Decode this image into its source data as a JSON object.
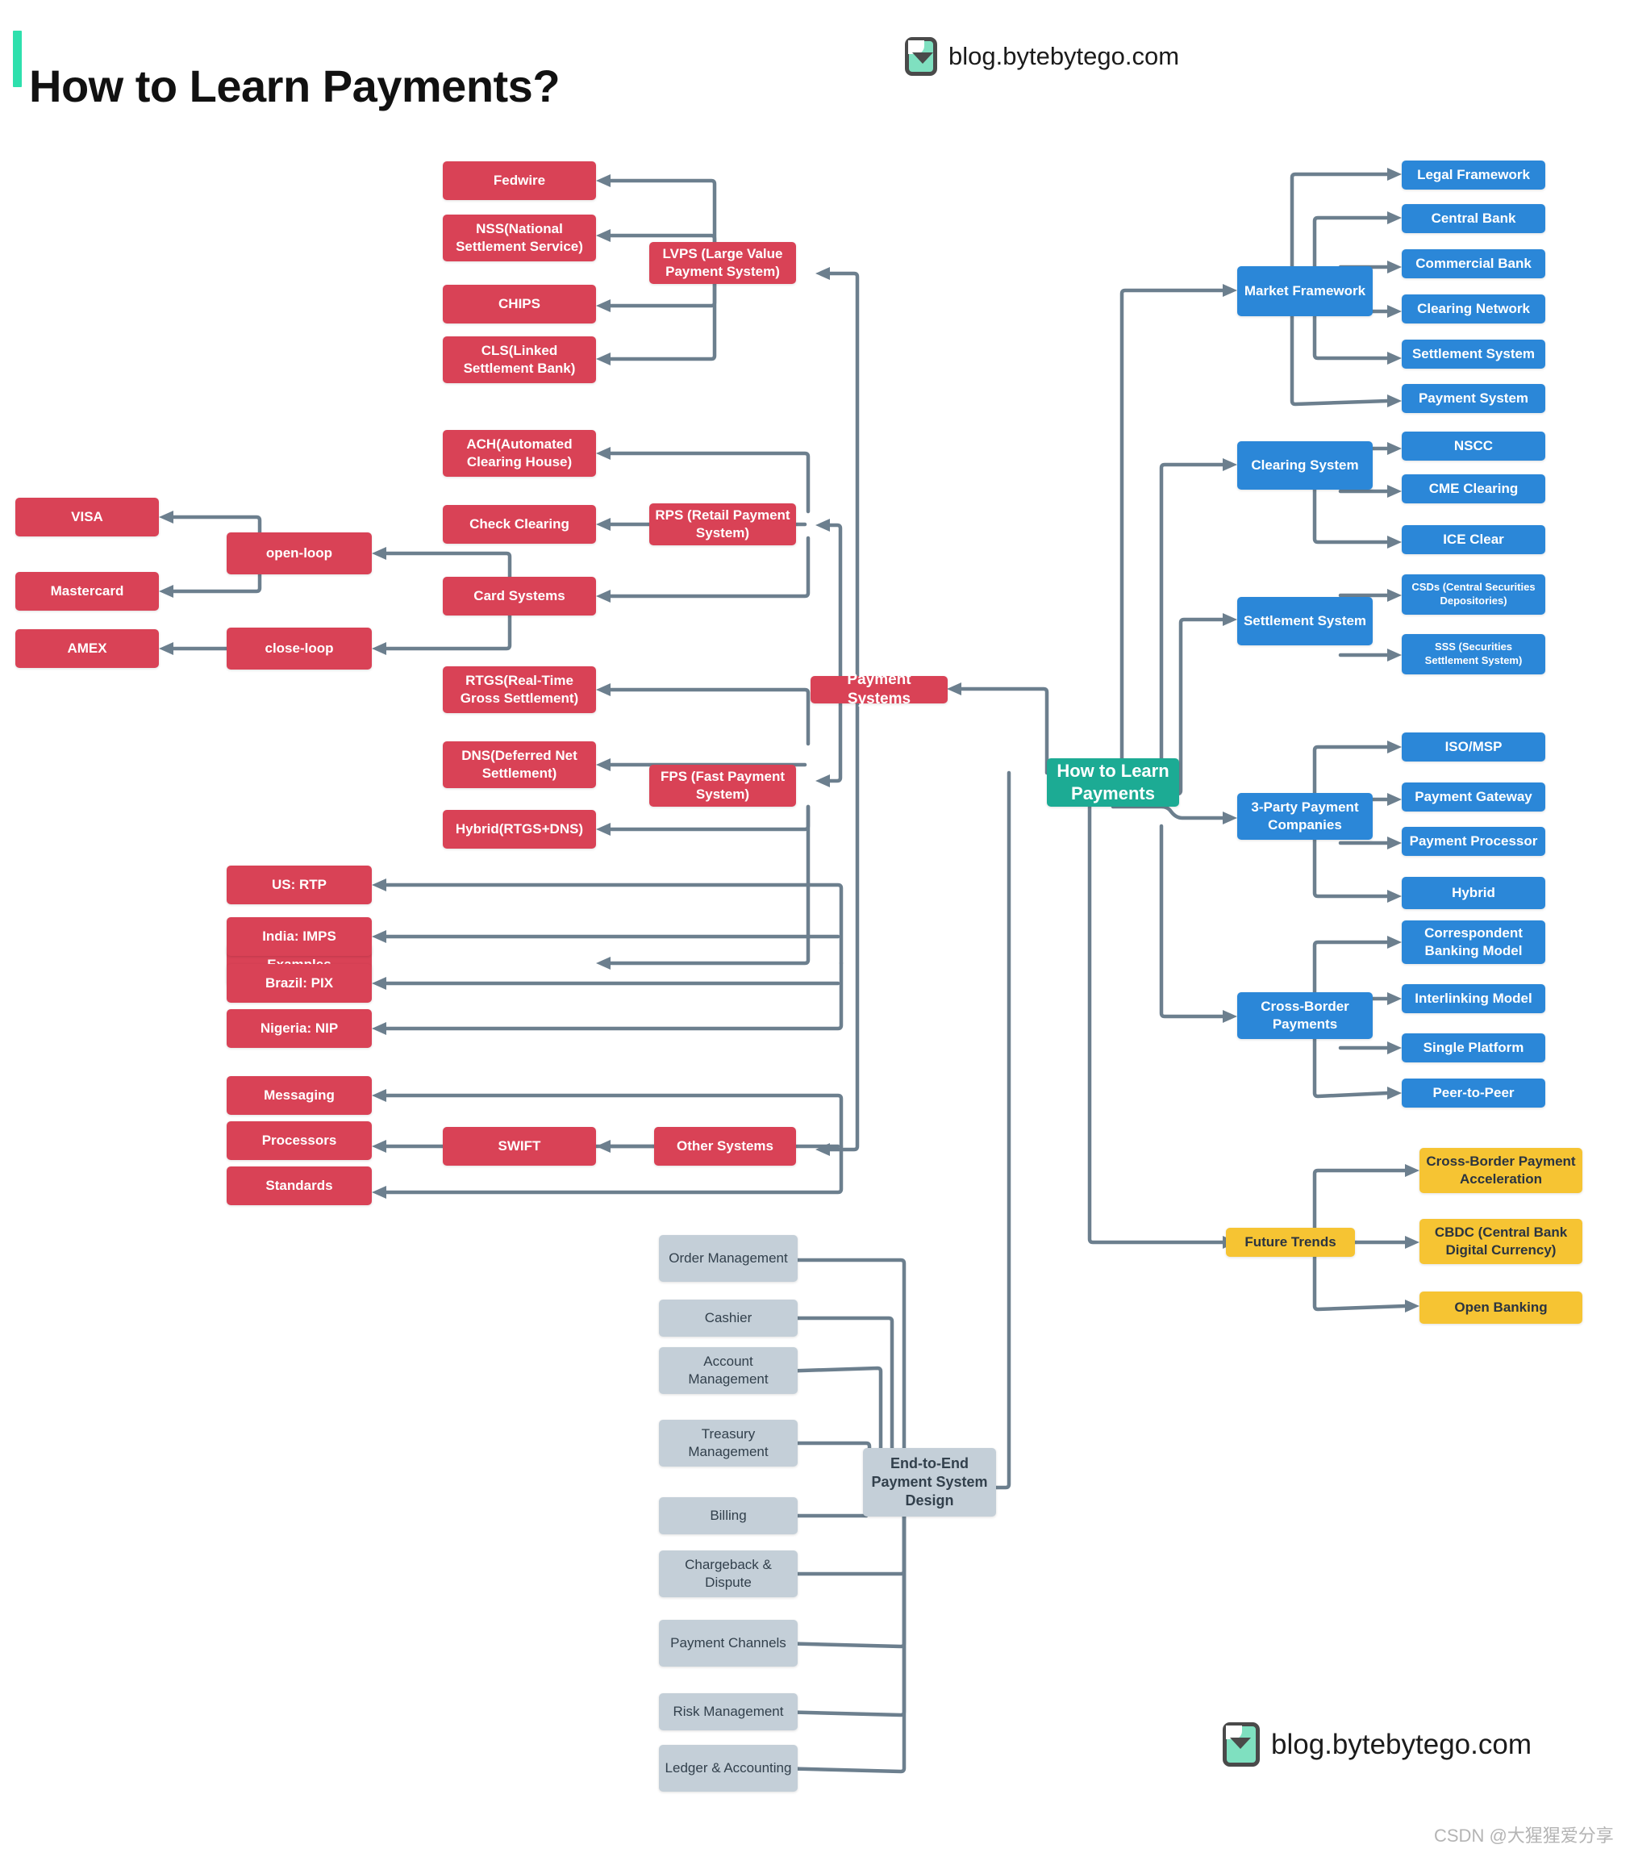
{
  "header": {
    "title": "How to Learn Payments?",
    "brand_top": "blog.bytebytego.com",
    "brand_bottom": "blog.bytebytego.com",
    "watermark": "CSDN @大猩猩爱分享",
    "accent_color": "#2ee0ad"
  },
  "colors": {
    "red": "#d94256",
    "blue": "#2b87d8",
    "teal": "#1cab94",
    "amber": "#f6c433",
    "grey": "#c4cfd8",
    "connector": "#6c7f8e"
  },
  "root": {
    "label": "How to Learn Payments"
  },
  "branches": {
    "payment_systems": {
      "label": "Payment Systems",
      "children": [
        {
          "label": "LVPS (Large Value Payment System)",
          "children": [
            {
              "label": "Fedwire"
            },
            {
              "label": "NSS(National Settlement Service)"
            },
            {
              "label": "CHIPS"
            },
            {
              "label": "CLS(Linked Settlement Bank)"
            }
          ]
        },
        {
          "label": "RPS (Retail Payment System)",
          "children": [
            {
              "label": "ACH(Automated Clearing House)"
            },
            {
              "label": "Check Clearing"
            },
            {
              "label": "Card Systems",
              "children": [
                {
                  "label": "open-loop",
                  "children": [
                    {
                      "label": "VISA"
                    },
                    {
                      "label": "Mastercard"
                    }
                  ]
                },
                {
                  "label": "close-loop",
                  "children": [
                    {
                      "label": "AMEX"
                    }
                  ]
                }
              ]
            }
          ]
        },
        {
          "label": "FPS (Fast Payment System)",
          "children": [
            {
              "label": "RTGS(Real-Time Gross Settlement)"
            },
            {
              "label": "DNS(Deferred Net Settlement)"
            },
            {
              "label": "Hybrid(RTGS+DNS)"
            },
            {
              "label": "Examples",
              "children": [
                {
                  "label": "US: RTP"
                },
                {
                  "label": "India: IMPS"
                },
                {
                  "label": "Brazil: PIX"
                },
                {
                  "label": "Nigeria: NIP"
                }
              ]
            }
          ]
        },
        {
          "label": "Other Systems",
          "children": [
            {
              "label": "SWIFT",
              "children": [
                {
                  "label": "Messaging"
                },
                {
                  "label": "Processors"
                },
                {
                  "label": "Standards"
                }
              ]
            }
          ]
        }
      ]
    },
    "market_framework": {
      "label": "Market Framework",
      "children": [
        {
          "label": "Legal Framework"
        },
        {
          "label": "Central Bank"
        },
        {
          "label": "Commercial Bank"
        },
        {
          "label": "Clearing Network"
        },
        {
          "label": "Settlement System"
        },
        {
          "label": "Payment System"
        }
      ]
    },
    "clearing_system": {
      "label": "Clearing System",
      "children": [
        {
          "label": "NSCC"
        },
        {
          "label": "CME Clearing"
        },
        {
          "label": "ICE Clear"
        }
      ]
    },
    "settlement_system": {
      "label": "Settlement System",
      "children": [
        {
          "label": "CSDs (Central Securities Depositories)"
        },
        {
          "label": "SSS (Securities Settlement System)"
        }
      ]
    },
    "third_party": {
      "label": "3-Party Payment Companies",
      "children": [
        {
          "label": "ISO/MSP"
        },
        {
          "label": "Payment Gateway"
        },
        {
          "label": "Payment Processor"
        },
        {
          "label": "Hybrid"
        }
      ]
    },
    "cross_border": {
      "label": "Cross-Border Payments",
      "children": [
        {
          "label": "Correspondent Banking Model"
        },
        {
          "label": "Interlinking Model"
        },
        {
          "label": "Single Platform"
        },
        {
          "label": "Peer-to-Peer"
        }
      ]
    },
    "future_trends": {
      "label": "Future Trends",
      "children": [
        {
          "label": "Cross-Border Payment Acceleration"
        },
        {
          "label": "CBDC (Central Bank Digital Currency)"
        },
        {
          "label": "Open Banking"
        }
      ]
    },
    "e2e_design": {
      "label": "End-to-End Payment System Design",
      "children": [
        {
          "label": "Order Management"
        },
        {
          "label": "Cashier"
        },
        {
          "label": "Account Management"
        },
        {
          "label": "Treasury Management"
        },
        {
          "label": "Billing"
        },
        {
          "label": "Chargeback & Dispute"
        },
        {
          "label": "Payment Channels"
        },
        {
          "label": "Risk Management"
        },
        {
          "label": "Ledger & Accounting"
        }
      ]
    }
  }
}
